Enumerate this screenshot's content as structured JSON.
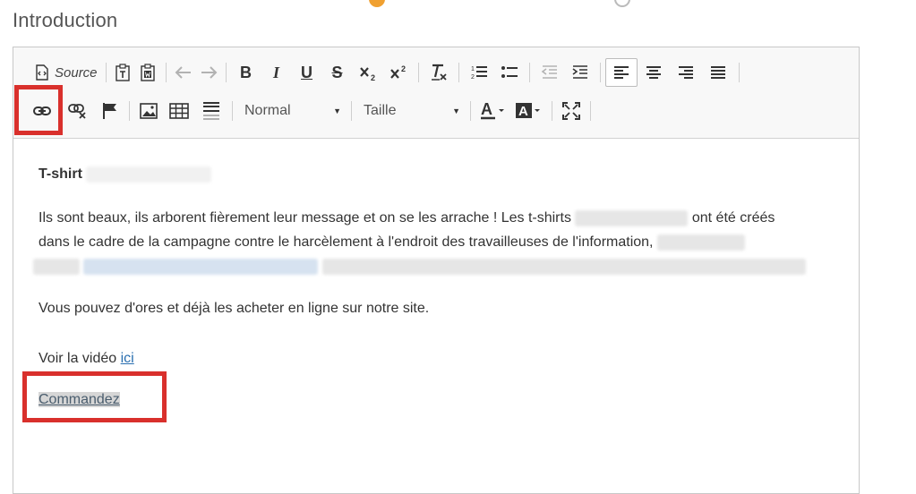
{
  "section": {
    "title": "Introduction"
  },
  "toolbar": {
    "source_label": "Source",
    "bold_label": "B",
    "italic_label": "I",
    "underline_label": "U",
    "strike_label": "S",
    "format_value": "Normal",
    "size_value": "Taille"
  },
  "content": {
    "title": "T-shirt",
    "paragraph_part1": "Ils sont beaux, ils arborent fièrement leur message et on se les arrache ! Les t-shirts",
    "paragraph_part2": "ont été créés",
    "paragraph_line2": "dans le cadre de la campagne contre le harcèlement à l'endroit des travailleuses de l'information,",
    "paragraph_buy": "Vous pouvez d'ores et déjà les acheter en ligne sur notre site.",
    "video_text": "Voir la vidéo",
    "video_link": "ici",
    "order_link": "Commandez"
  },
  "colors": {
    "highlight": "#d9302c",
    "link": "#2a6fb0",
    "accent_dot": "#f0a030"
  }
}
